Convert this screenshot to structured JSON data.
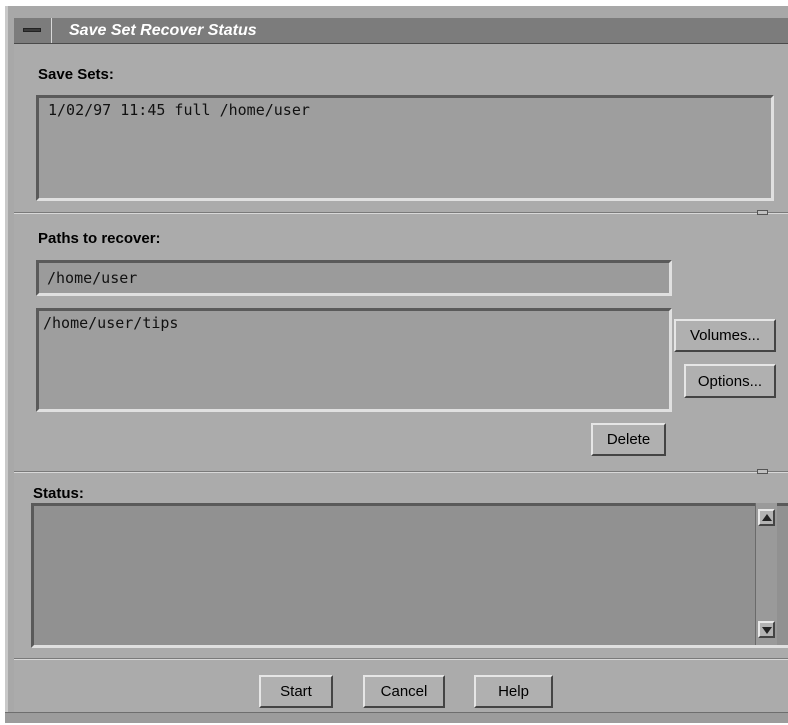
{
  "window": {
    "title": "Save Set Recover Status"
  },
  "save_sets": {
    "label": "Save Sets:",
    "entries": [
      "1/02/97 11:45 full /home/user"
    ]
  },
  "paths": {
    "label": "Paths to recover:",
    "path_field_value": "/home/user",
    "list": [
      "/home/user/tips"
    ],
    "volumes_label": "Volumes...",
    "options_label": "Options...",
    "delete_label": "Delete"
  },
  "status": {
    "label": "Status:",
    "text": ""
  },
  "footer": {
    "start_label": "Start",
    "cancel_label": "Cancel",
    "help_label": "Help"
  }
}
